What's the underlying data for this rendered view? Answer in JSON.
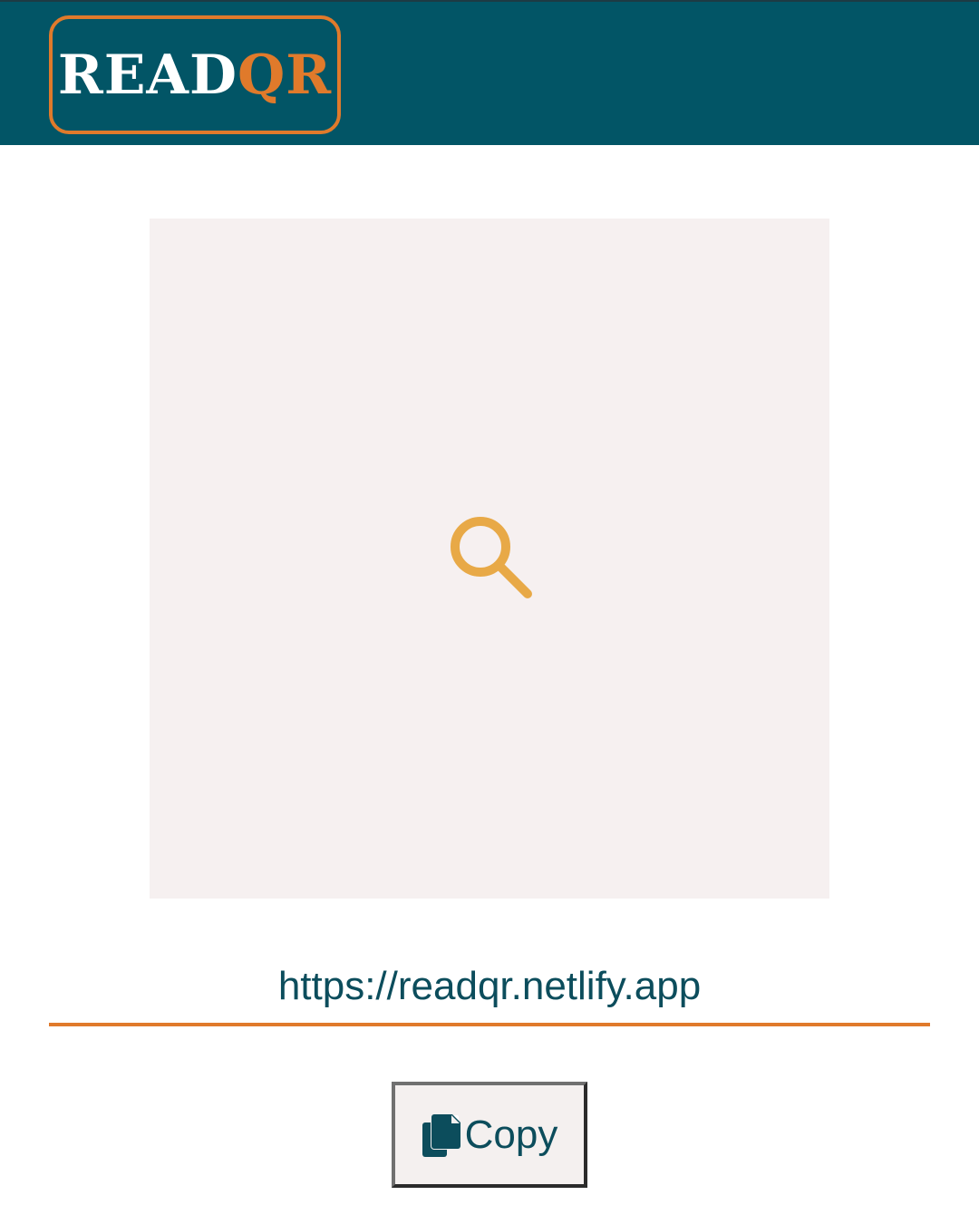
{
  "header": {
    "logo_part1": "READ",
    "logo_part2": "QR",
    "background_color": "#025566",
    "accent_color": "#e07a2b"
  },
  "scanner": {
    "icon": "search-icon",
    "background_color": "#f6f0f0"
  },
  "result": {
    "url_text": "https://readqr.netlify.app"
  },
  "actions": {
    "copy_icon": "copy-icon",
    "copy_label": "Copy"
  }
}
